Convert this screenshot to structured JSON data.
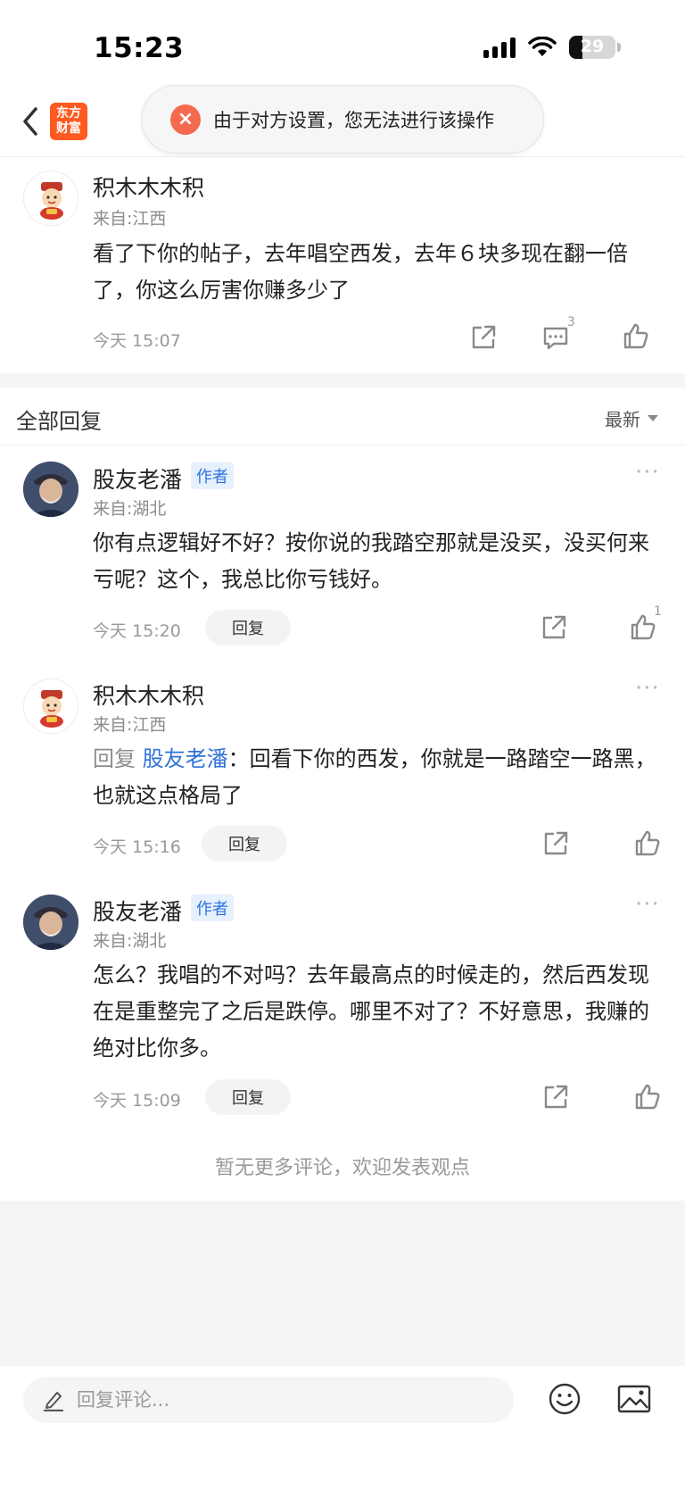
{
  "status_bar": {
    "time": "15:23",
    "battery": "29",
    "battery_level": 0.29
  },
  "header": {
    "logo_text": "东方财富",
    "logo_line1": "东方",
    "logo_line2": "财富"
  },
  "toast": {
    "icon": "close-icon",
    "text": "由于对方设置，您无法进行该操作"
  },
  "post": {
    "author": "积木木木积",
    "from": "来自:江西",
    "content": "看了下你的帖子，去年唱空西发，去年６块多现在翻一倍了，你这么厉害你赚多少了",
    "time": "今天 15:07",
    "comment_count": "3"
  },
  "replies_header": {
    "title": "全部回复",
    "sort_label": "最新"
  },
  "replies": [
    {
      "author": "股友老潘",
      "badge": "作者",
      "from": "来自:湖北",
      "content": "你有点逻辑好不好？按你说的我踏空那就是没买，没买何来亏呢？这个，我总比你亏钱好。",
      "time": "今天 15:20",
      "reply_label": "回复",
      "like_count": "1",
      "more": "···"
    },
    {
      "author": "积木木木积",
      "from": "来自:江西",
      "reply_prefix": "回复",
      "reply_target": "股友老潘",
      "content": "：回看下你的西发，你就是一路踏空一路黑，也就这点格局了",
      "time": "今天 15:16",
      "reply_label": "回复",
      "more": "···"
    },
    {
      "author": "股友老潘",
      "badge": "作者",
      "from": "来自:湖北",
      "content": "怎么？我唱的不对吗？去年最高点的时候走的，然后西发现在是重整完了之后是跌停。哪里不对了？不好意思，我赚的绝对比你多。",
      "time": "今天 15:09",
      "reply_label": "回复",
      "more": "···"
    }
  ],
  "footer_note": "暂无更多评论，欢迎发表观点",
  "bottom_bar": {
    "placeholder": "回复评论..."
  },
  "colors": {
    "accent_orange": "#ff5a1f",
    "toast_red": "#f46a4f",
    "link_blue": "#2f73d9"
  }
}
